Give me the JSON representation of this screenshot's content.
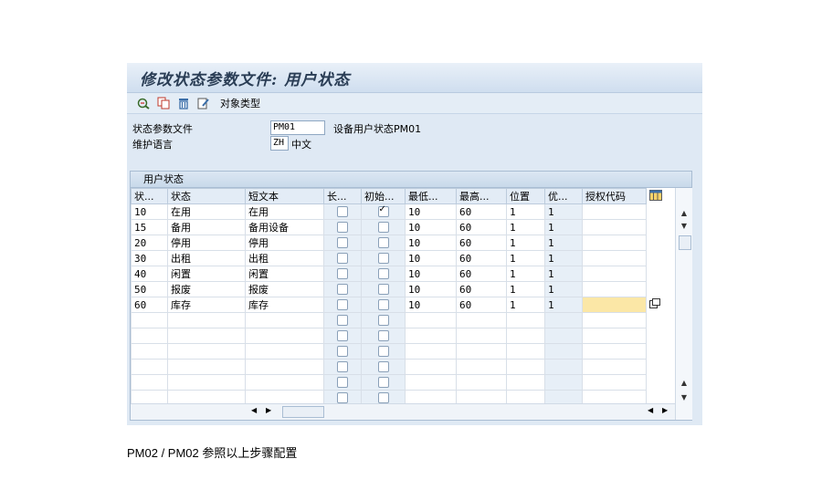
{
  "window": {
    "title": "修改状态参数文件: 用户状态"
  },
  "toolbar": {
    "icons": [
      "display-change-icon",
      "copy-icon",
      "delete-icon",
      "details-icon"
    ],
    "object_types_label": "对象类型"
  },
  "fields": {
    "profile_label": "状态参数文件",
    "profile_value": "PM01",
    "profile_desc": "设备用户状态PM01",
    "language_label": "维护语言",
    "language_value": "ZH",
    "language_desc": "中文"
  },
  "table": {
    "caption": "用户状态",
    "headers": [
      "状...",
      "状态",
      "短文本",
      "长...",
      "初始...",
      "最低...",
      "最高...",
      "位置",
      "优...",
      "授权代码"
    ],
    "rows": [
      {
        "no": "10",
        "status": "在用",
        "text": "在用",
        "long": false,
        "init": true,
        "min": "10",
        "max": "60",
        "pos": "1",
        "prio": "1",
        "auth": ""
      },
      {
        "no": "15",
        "status": "备用",
        "text": "备用设备",
        "long": false,
        "init": false,
        "min": "10",
        "max": "60",
        "pos": "1",
        "prio": "1",
        "auth": ""
      },
      {
        "no": "20",
        "status": "停用",
        "text": "停用",
        "long": false,
        "init": false,
        "min": "10",
        "max": "60",
        "pos": "1",
        "prio": "1",
        "auth": ""
      },
      {
        "no": "30",
        "status": "出租",
        "text": "出租",
        "long": false,
        "init": false,
        "min": "10",
        "max": "60",
        "pos": "1",
        "prio": "1",
        "auth": ""
      },
      {
        "no": "40",
        "status": "闲置",
        "text": "闲置",
        "long": false,
        "init": false,
        "min": "10",
        "max": "60",
        "pos": "1",
        "prio": "1",
        "auth": ""
      },
      {
        "no": "50",
        "status": "报废",
        "text": "报废",
        "long": false,
        "init": false,
        "min": "10",
        "max": "60",
        "pos": "1",
        "prio": "1",
        "auth": ""
      },
      {
        "no": "60",
        "status": "库存",
        "text": "库存",
        "long": false,
        "init": false,
        "min": "10",
        "max": "60",
        "pos": "1",
        "prio": "1",
        "auth": ""
      }
    ],
    "empty_rows": 6
  },
  "caption": "PM02 / PM02  参照以上步骤配置",
  "colors": {
    "accent": "#2a3d55",
    "selected_cell": "#fbe7a6"
  }
}
